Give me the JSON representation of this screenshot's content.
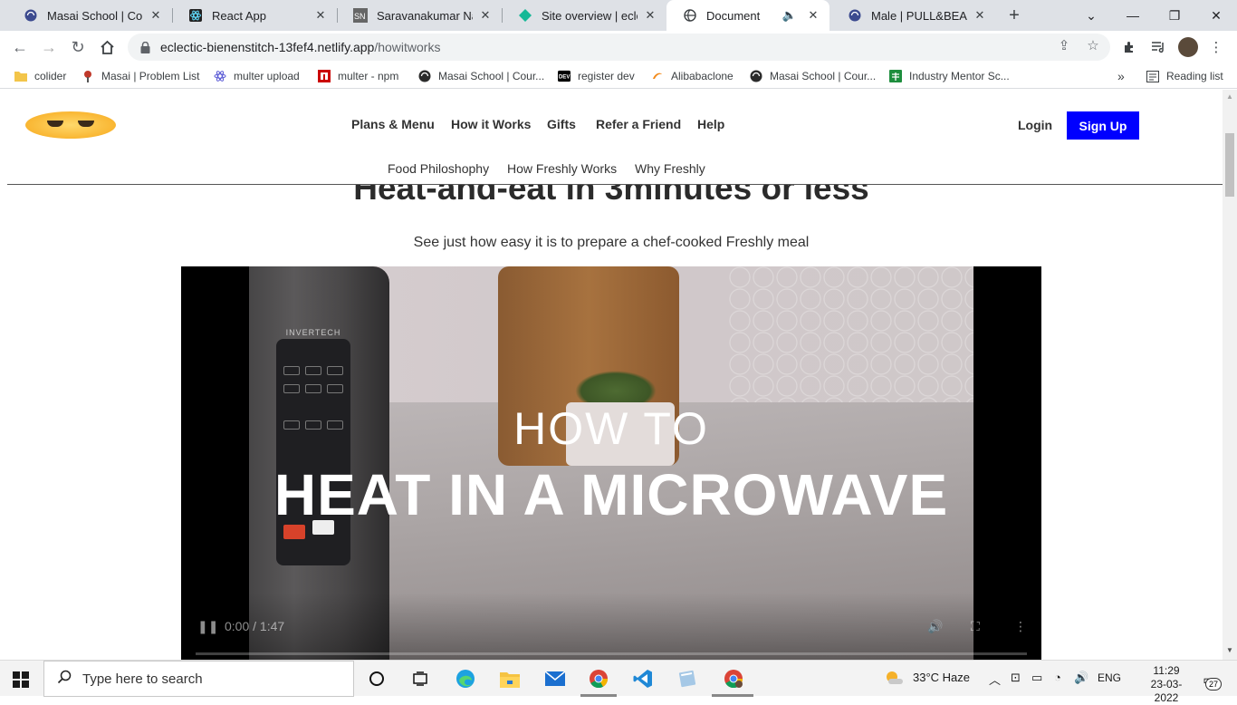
{
  "browser": {
    "tabs": [
      {
        "title": "Masai School | Course",
        "icon": "masai-icon",
        "active": false
      },
      {
        "title": "React App",
        "icon": "react-icon",
        "active": false
      },
      {
        "title": "Saravanakumar Nagar",
        "icon": "sn-icon",
        "active": false
      },
      {
        "title": "Site overview | eclectic",
        "icon": "netlify-icon",
        "active": false
      },
      {
        "title": "Document",
        "icon": "globe-icon",
        "active": true,
        "audio": true
      },
      {
        "title": "Male | PULL&BEAR Pu",
        "icon": "globe-icon",
        "active": false
      }
    ],
    "url": {
      "domain": "eclectic-bienenstitch-13fef4.netlify.app",
      "path": "/howitworks"
    },
    "bookmarks": [
      {
        "label": "colider",
        "icon": "folder-icon"
      },
      {
        "label": "Masai | Problem List",
        "icon": "masai-bookmark-icon"
      },
      {
        "label": "multer upload",
        "icon": "react-icon"
      },
      {
        "label": "multer - npm",
        "icon": "npm-icon"
      },
      {
        "label": "Masai School | Cour...",
        "icon": "masai-icon"
      },
      {
        "label": "register dev",
        "icon": "dev-icon"
      },
      {
        "label": "Alibabaclone",
        "icon": "alibaba-icon"
      },
      {
        "label": "Masai School | Cour...",
        "icon": "masai-icon"
      },
      {
        "label": "Industry Mentor Sc...",
        "icon": "sheets-icon"
      }
    ],
    "reading_list": "Reading list"
  },
  "site": {
    "nav": {
      "items": [
        "Plans & Menu",
        "How it Works",
        "Gifts",
        "Refer a Friend",
        "Help"
      ],
      "login": "Login",
      "signup": "Sign Up"
    },
    "subnav": [
      "Food Philoshophy",
      "How Freshly Works",
      "Why Freshly"
    ],
    "headline": "Heat-and-eat in 3minutes or less",
    "subtitle": "See just how easy it is to prepare a chef-cooked Freshly meal",
    "video": {
      "overlay_small": "HOW TO",
      "overlay_large": "HEAT IN A MICROWAVE",
      "brand": "INVERTECH",
      "current_time": "0:00",
      "duration": "1:47",
      "progress_fraction": 0
    },
    "colors": {
      "signup_bg": "#0000ff",
      "signup_text": "#ffffff"
    }
  },
  "taskbar": {
    "search_placeholder": "Type here to search",
    "weather": "33°C  Haze",
    "language": "ENG",
    "time": "11:29",
    "date": "23-03-2022",
    "notifications": "27"
  }
}
